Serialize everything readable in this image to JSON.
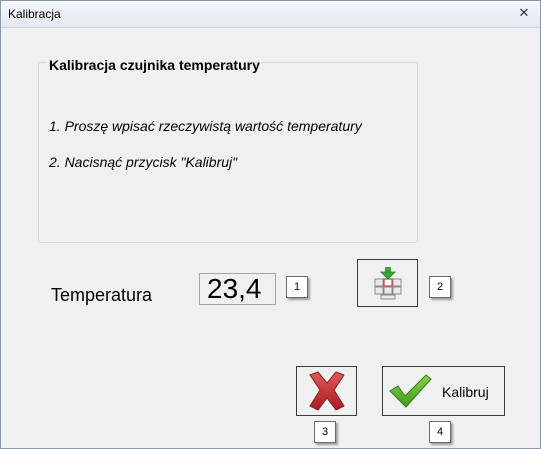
{
  "window": {
    "title": "Kalibracja",
    "close_glyph": "✕"
  },
  "group": {
    "title": "Kalibracja czujnika temperatury",
    "instruction_1": "1. Proszę wpisać rzeczywistą wartość temperatury",
    "instruction_2": "2. Nacisnąć przycisk \"Kalibruj\""
  },
  "temperature": {
    "label": "Temperatura",
    "value": "23,4"
  },
  "buttons": {
    "read_icon": "keyboard-download-icon",
    "cancel_icon": "red-x-icon",
    "calibrate_icon": "green-checkmark-icon",
    "calibrate_label": "Kalibruj"
  },
  "tags": {
    "tag1": "1",
    "tag2": "2",
    "tag3": "3",
    "tag4": "4"
  },
  "colors": {
    "cancel_red": "#c0282c",
    "check_green": "#58b22e",
    "download_green": "#3aa63a"
  }
}
